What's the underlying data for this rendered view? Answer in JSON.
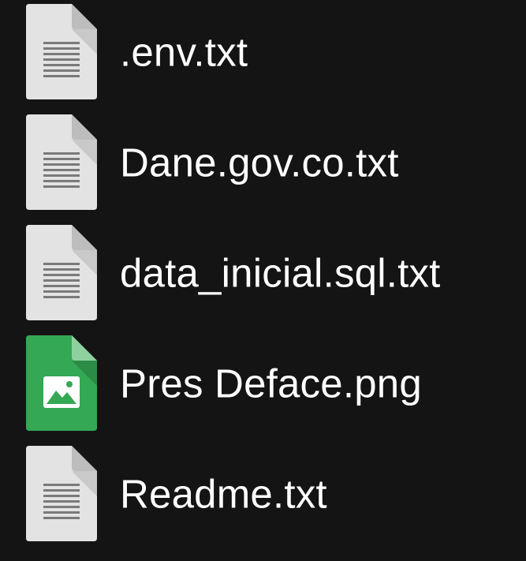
{
  "files": [
    {
      "name": ".env.txt",
      "icon": "text-file-icon"
    },
    {
      "name": "Dane.gov.co.txt",
      "icon": "text-file-icon"
    },
    {
      "name": "data_inicial.sql.txt",
      "icon": "text-file-icon"
    },
    {
      "name": "Pres Deface.png",
      "icon": "image-file-icon"
    },
    {
      "name": "Readme.txt",
      "icon": "text-file-icon"
    }
  ],
  "colors": {
    "background": "#141414",
    "text_file_icon": "#e3e3e3",
    "image_file_icon": "#34a853",
    "label": "#ffffff"
  }
}
